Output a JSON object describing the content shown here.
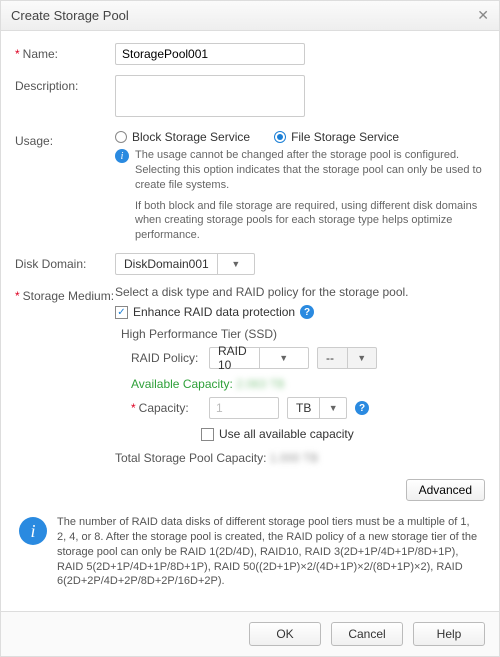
{
  "title": "Create Storage Pool",
  "form": {
    "name": {
      "label": "Name:",
      "value": "StoragePool001"
    },
    "description": {
      "label": "Description:",
      "value": ""
    },
    "usage": {
      "label": "Usage:",
      "options": {
        "block": "Block Storage Service",
        "file": "File Storage Service"
      },
      "selected": "file",
      "info1": "The usage cannot be changed after the storage pool is configured. Selecting this option indicates that the storage pool can only be used to create file systems.",
      "info2": "If both block and file storage are required, using different disk domains when creating storage pools for each storage type helps optimize performance."
    },
    "diskDomain": {
      "label": "Disk Domain:",
      "value": "DiskDomain001"
    },
    "storageMedium": {
      "label": "Storage Medium:",
      "hint": "Select a disk type and RAID policy for the storage pool.",
      "enhance": {
        "checked": true,
        "label": "Enhance RAID data protection"
      },
      "tierTitle": "High Performance Tier (SSD)",
      "raid": {
        "label": "RAID Policy:",
        "value": "RAID 10",
        "secondary": "--"
      },
      "available": {
        "label": "Available Capacity:",
        "value": "2.063 TB"
      },
      "capacity": {
        "label": "Capacity:",
        "value": "1",
        "unit": "TB"
      },
      "useAll": {
        "checked": false,
        "label": "Use all available capacity"
      },
      "total": {
        "label": "Total Storage Pool Capacity:",
        "value": "1.000 TB"
      }
    }
  },
  "advanced": "Advanced",
  "note": "The number of RAID data disks of different storage pool tiers must be a multiple of 1, 2, 4, or 8. After the storage pool is created, the RAID policy of a new storage tier of the storage pool can only be RAID 1(2D/4D), RAID10, RAID 3(2D+1P/4D+1P/8D+1P), RAID 5(2D+1P/4D+1P/8D+1P), RAID 50((2D+1P)×2/(4D+1P)×2/(8D+1P)×2), RAID 6(2D+2P/4D+2P/8D+2P/16D+2P).",
  "footer": {
    "ok": "OK",
    "cancel": "Cancel",
    "help": "Help"
  }
}
